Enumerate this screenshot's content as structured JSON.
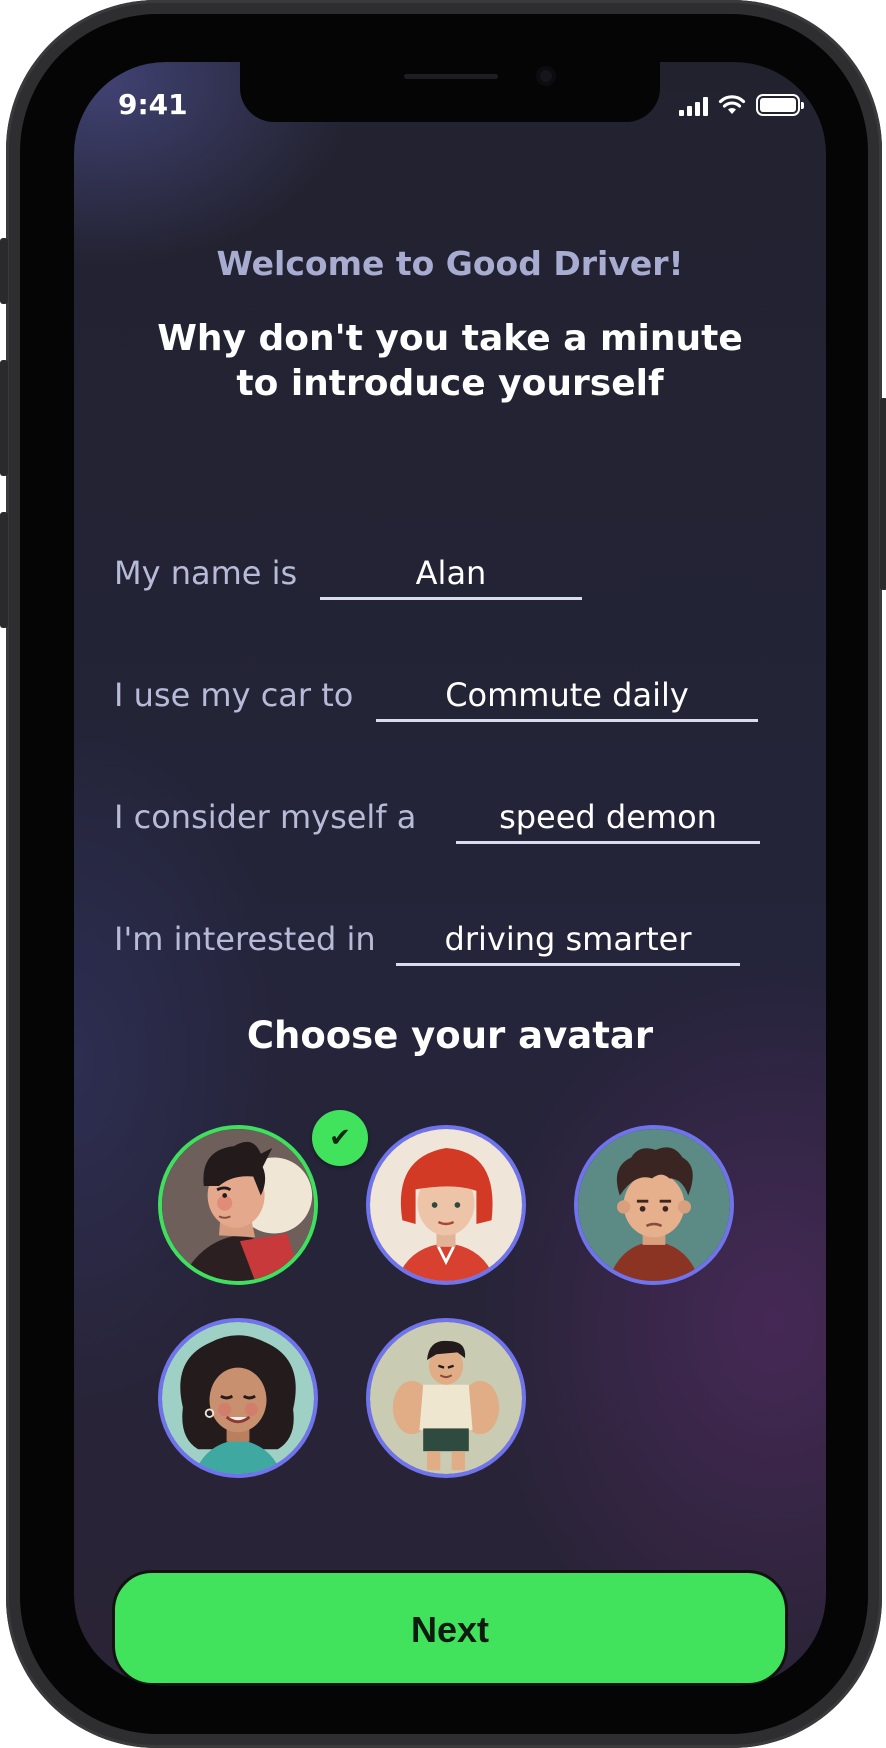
{
  "status_bar": {
    "time": "9:41"
  },
  "welcome_text": "Welcome to Good Driver!",
  "headline": "Why don't you take a minute to introduce yourself",
  "form": {
    "name": {
      "label": "My name is",
      "value": "Alan"
    },
    "car_use": {
      "label": "I use my car to",
      "value": "Commute daily"
    },
    "driver_type": {
      "label": "I consider myself a",
      "value": "speed demon"
    },
    "interest": {
      "label": "I'm interested in",
      "value": "driving smarter"
    }
  },
  "avatar_section": {
    "title": "Choose your avatar",
    "selected_index": 0,
    "check_icon": "✔",
    "avatars": [
      {
        "name": "spiky-hair-man"
      },
      {
        "name": "red-hair-woman"
      },
      {
        "name": "curly-hair-boy"
      },
      {
        "name": "curly-hair-woman"
      },
      {
        "name": "muscular-man"
      }
    ]
  },
  "next_button": {
    "label": "Next"
  },
  "colors": {
    "accent_green": "#41e25c",
    "avatar_ring": "#6f73ee",
    "label_text": "#b7bbd8",
    "welcome_text": "#a8acd0"
  }
}
